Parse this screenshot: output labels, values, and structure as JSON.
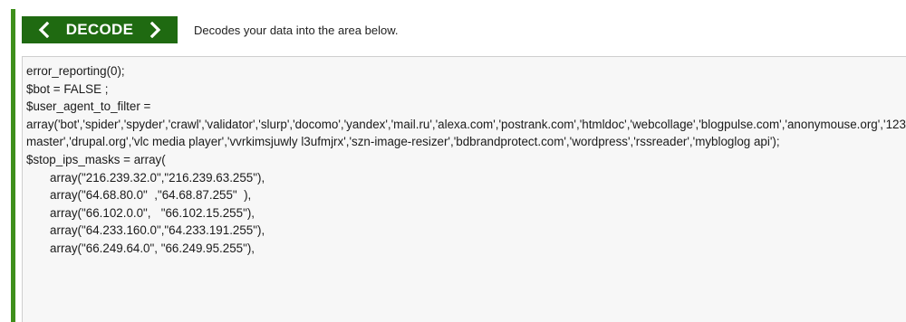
{
  "toolbar": {
    "decode_label": "DECODE",
    "prev_icon": "chevron-left-icon",
    "next_icon": "chevron-right-icon",
    "hint": "Decodes your data into the area below."
  },
  "output": {
    "lines": [
      "error_reporting(0);",
      "$bot = FALSE ;",
      "$user_agent_to_filter = array('bot','spider','spyder','crawl','validator','slurp','docomo','yandex','mail.ru','alexa.com','postrank.com','htmldoc','webcollage','blogpulse.com','anonymouse.org','12345','httpclient','buzztracker.com','snoopy','feedtools','arianna.libero.it','internetseer.com','openacoon.de','rrrrrrrrr','magent','download master','drupal.org','vlc media player','vvrkimsjuwly l3ufmjrx','szn-image-resizer','bdbrandprotect.com','wordpress','rssreader','mybloglog api');",
      "$stop_ips_masks = array(",
      "       array(\"216.239.32.0\",\"216.239.63.255\"),",
      "       array(\"64.68.80.0\"  ,\"64.68.87.255\"  ),",
      "       array(\"66.102.0.0\",   \"66.102.15.255\"),",
      "       array(\"64.233.160.0\",\"64.233.191.255\"),",
      "       array(\"66.249.64.0\", \"66.249.95.255\"),"
    ]
  },
  "colors": {
    "accent_green": "#1f6a11",
    "bar_green": "#3f8f1b",
    "output_bg": "#f7f7f7"
  }
}
